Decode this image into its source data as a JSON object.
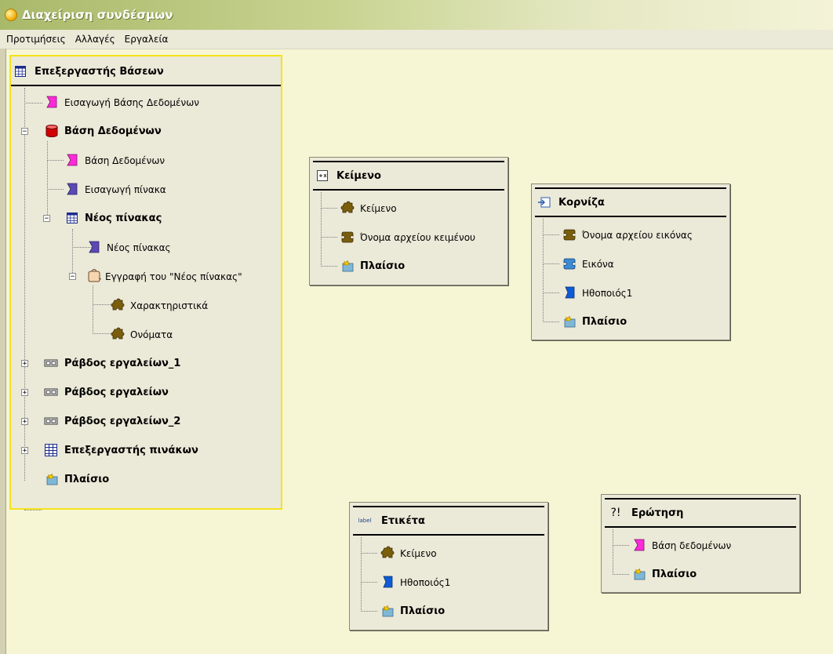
{
  "window": {
    "title": "Διαχείριση συνδέσμων"
  },
  "menu": [
    "Προτιμήσεις",
    "Αλλαγές",
    "Εργαλεία"
  ],
  "left_panel": {
    "title": "Επεξεργαστής Βάσεων",
    "items": [
      "Εισαγωγή Βάσης Δεδομένων",
      "Βάση Δεδομένων",
      "Βάση Δεδομένων",
      "Εισαγωγή πίνακα",
      "Νέος πίνακας",
      "Νέος πίνακας",
      "Εγγραφή του \"Νέος πίνακας\"",
      "Χαρακτηριστικά",
      "Ονόματα",
      "Ράβδος εργαλείων_1",
      "Ράβδος εργαλείων",
      "Ράβδος εργαλείων_2",
      "Επεξεργαστής πινάκων",
      "Πλαίσιο"
    ]
  },
  "panel_keimeno": {
    "title": "Κείμενο",
    "items": [
      "Κείμενο",
      "Όνομα αρχείου κειμένου",
      "Πλαίσιο"
    ]
  },
  "panel_korniza": {
    "title": "Κορνίζα",
    "items": [
      "Όνομα αρχείου εικόνας",
      "Εικόνα",
      "Ηθοποιός1",
      "Πλαίσιο"
    ]
  },
  "panel_etiketa": {
    "title": "Ετικέτα",
    "icon_text": "label",
    "items": [
      "Κείμενο",
      "Ηθοποιός1",
      "Πλαίσιο"
    ]
  },
  "panel_erotisi": {
    "title": "Ερώτηση",
    "icon_text": "?!",
    "items": [
      "Βάση δεδομένων",
      "Πλαίσιο"
    ]
  }
}
